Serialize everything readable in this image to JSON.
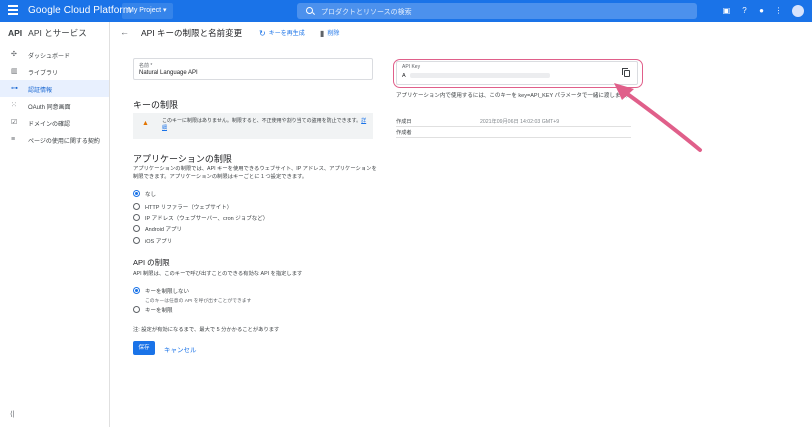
{
  "topbar": {
    "logo": "Google Cloud Platform",
    "project": "My Project ▾",
    "search_placeholder": "プロダクトとリソースの検索",
    "icons": [
      "gift-icon",
      "help-icon",
      "notification-icon",
      "more-icon"
    ]
  },
  "sidebar": {
    "api_label": "API",
    "title": "API とサービス",
    "items": [
      {
        "label": "ダッシュボード",
        "icon": "dashboard-icon"
      },
      {
        "label": "ライブラリ",
        "icon": "library-icon"
      },
      {
        "label": "認証情報",
        "icon": "key-icon",
        "active": true
      },
      {
        "label": "OAuth 同意画面",
        "icon": "consent-icon"
      },
      {
        "label": "ドメインの確認",
        "icon": "domain-icon"
      },
      {
        "label": "ページの使用に関する契約",
        "icon": "settings-icon"
      }
    ],
    "collapse": "⟨|"
  },
  "header": {
    "title": "API キーの制限と名前変更",
    "regenerate_label": "キーを再生成",
    "delete_label": "削除"
  },
  "form": {
    "name_label": "名前 *",
    "name_value": "Natural Language API",
    "key_restrictions_title": "キーの制限",
    "warning_text": "このキーに制限はありません。制限すると、不正使用や割り当ての盗用を防止できます。",
    "warning_link": "詳細",
    "app_restrictions_title": "アプリケーションの制限",
    "app_restrictions_desc": "アプリケーションの制限では、API キーを使用できるウェブサイト、IP アドレス、アプリケーションを制限できます。アプリケーションの制限はキーごとに 1 つ設定できます。",
    "app_options": [
      {
        "label": "なし",
        "selected": true
      },
      {
        "label": "HTTP リファラー（ウェブサイト）",
        "selected": false
      },
      {
        "label": "IP アドレス（ウェブサーバー、cron ジョブなど）",
        "selected": false
      },
      {
        "label": "Android アプリ",
        "selected": false
      },
      {
        "label": "iOS アプリ",
        "selected": false
      }
    ],
    "api_restrictions_title": "API の制限",
    "api_restrictions_desc": "API 制限は、このキーで呼び出すことのできる有効な API を指定します",
    "api_options": [
      {
        "label": "キーを制限しない",
        "sub": "このキーは任意の API を呼び出すことができます",
        "selected": true
      },
      {
        "label": "キーを制限",
        "sub": "",
        "selected": false
      }
    ],
    "note": "注: 設定が有効になるまで、最大で 5 分かかることがあります",
    "save_label": "保存",
    "cancel_label": "キャンセル"
  },
  "right": {
    "api_key_label": "API Key",
    "api_key_prefix": "A",
    "usage_text": "アプリケーション内で使用するには、このキーを key=API_KEY パラメータで一緒に渡します。",
    "created_label": "作成日",
    "created_value": "2021年09月06日 14:02:03 GMT+9",
    "creator_label": "作成者",
    "creator_value": ""
  },
  "colors": {
    "brand": "#1a73e8",
    "highlight": "#e05f8a",
    "warning": "#e37400"
  }
}
